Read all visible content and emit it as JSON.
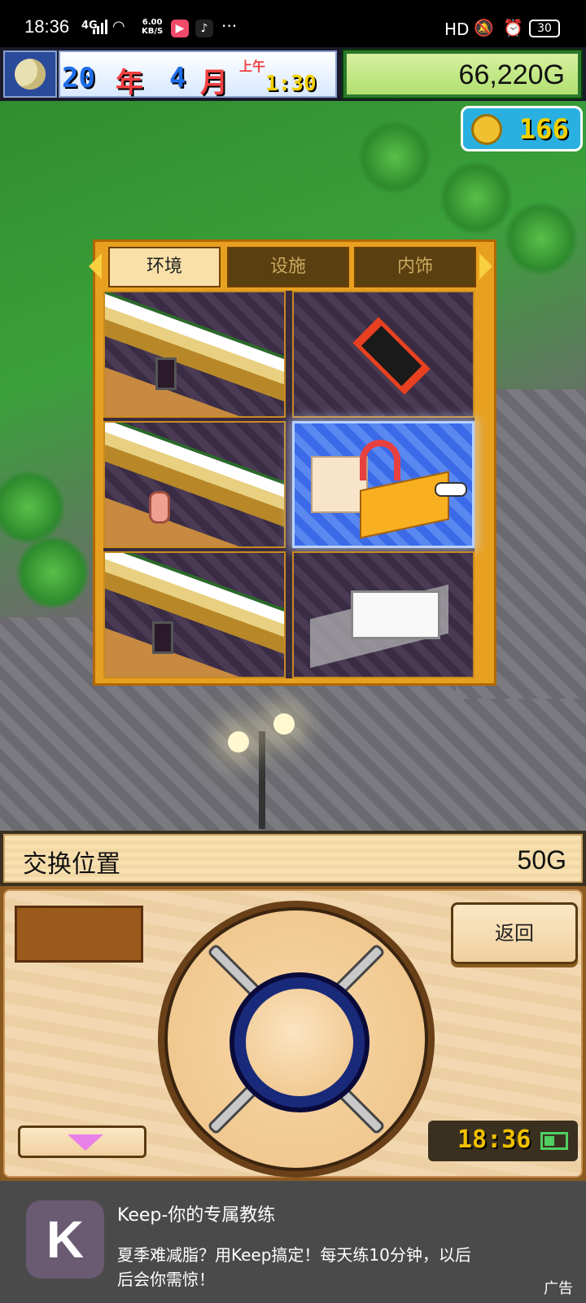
{
  "status_bar": {
    "time": "18:36",
    "network": "4G",
    "speed_top": "6.00",
    "speed_bottom": "KB/S",
    "more": "···",
    "hd": "HD",
    "battery": "30"
  },
  "hud": {
    "year": "20",
    "year_unit": "年",
    "month": "4",
    "month_unit": "月",
    "period": "上午",
    "clock": "1:30",
    "money": "66,220G",
    "coins": "166"
  },
  "build_panel": {
    "tabs": [
      "环境",
      "设施",
      "内饰"
    ],
    "active_tab": "环境",
    "selected_cell": 3
  },
  "action_bar": {
    "action": "交换位置",
    "cost": "50G"
  },
  "controls": {
    "back_label": "返回",
    "clock": "18:36"
  },
  "ad": {
    "logo": "K",
    "title": "Keep-你的专属教练",
    "description": "夏季难减脂？用Keep搞定！每天练10分钟，以后后会你需惊！",
    "label": "广告"
  },
  "icons": {
    "moon": "moon-icon",
    "coin": "coin-icon",
    "swap": "swap-icon",
    "pointer": "hand-pointer-icon",
    "down": "triangle-down-icon",
    "battery": "battery-icon"
  },
  "colors": {
    "panel_border": "#e8a020",
    "selected_cell": "#3a6ae8",
    "money_bg": "#b0e070",
    "coin_badge": "#2ab0e0",
    "ad_bg": "#4a4a4a"
  }
}
